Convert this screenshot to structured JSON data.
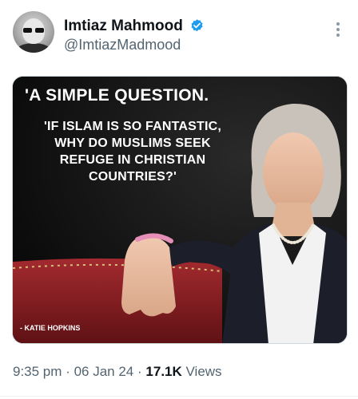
{
  "author": {
    "display_name": "Imtiaz Mahmood",
    "handle": "@ImtiazMadmood",
    "verified": true,
    "avatar_icon": "profile-photo"
  },
  "media": {
    "title": "'A SIMPLE QUESTION.",
    "quote_lines": [
      "'IF ISLAM IS SO FANTASTIC,",
      "WHY DO MUSLIMS SEEK",
      "REFUGE IN CHRISTIAN",
      "COUNTRIES?'"
    ],
    "attribution": "- KATIE HOPKINS"
  },
  "meta": {
    "time": "9:35 pm",
    "separator": "·",
    "date": "06 Jan 24",
    "views_count": "17.1K",
    "views_label": "Views"
  },
  "colors": {
    "text_primary": "#0f1419",
    "text_secondary": "#536471",
    "verified_blue": "#1d9bf0",
    "media_bg": "#0d0d0d",
    "chair_red": "#8e1e24"
  }
}
